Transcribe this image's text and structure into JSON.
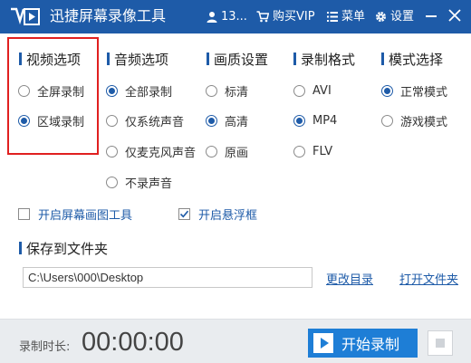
{
  "titlebar": {
    "title": "迅捷屏幕录像工具",
    "user": "13...",
    "buy_vip": "购买VIP",
    "menu": "菜单",
    "settings": "设置",
    "icons": [
      "logo-icon",
      "user-icon",
      "cart-icon",
      "menu-icon",
      "gear-icon",
      "minimize-icon",
      "close-icon"
    ]
  },
  "sections": {
    "video": {
      "label": "视频选项",
      "options": [
        {
          "label": "全屏录制",
          "checked": false
        },
        {
          "label": "区域录制",
          "checked": true
        }
      ]
    },
    "audio": {
      "label": "音频选项",
      "options": [
        {
          "label": "全部录制",
          "checked": true
        },
        {
          "label": "仅系统声音",
          "checked": false
        },
        {
          "label": "仅麦克风声音",
          "checked": false
        },
        {
          "label": "不录声音",
          "checked": false
        }
      ]
    },
    "quality": {
      "label": "画质设置",
      "options": [
        {
          "label": "标清",
          "checked": false
        },
        {
          "label": "高清",
          "checked": true
        },
        {
          "label": "原画",
          "checked": false
        }
      ]
    },
    "format": {
      "label": "录制格式",
      "options": [
        {
          "label": "AVI",
          "checked": false
        },
        {
          "label": "MP4",
          "checked": true
        },
        {
          "label": "FLV",
          "checked": false
        }
      ]
    },
    "mode": {
      "label": "模式选择",
      "options": [
        {
          "label": "正常模式",
          "checked": true
        },
        {
          "label": "游戏模式",
          "checked": false
        }
      ]
    }
  },
  "checkboxes": {
    "drawing_tool": {
      "label": "开启屏幕画图工具",
      "checked": false
    },
    "floating_frame": {
      "label": "开启悬浮框",
      "checked": true
    }
  },
  "save": {
    "label": "保存到文件夹",
    "path": "C:\\Users\\000\\Desktop",
    "change_dir": "更改目录",
    "open_folder": "打开文件夹"
  },
  "bottom": {
    "duration_label": "录制时长:",
    "duration_value": "00:00:00",
    "start_label": "开始录制"
  },
  "colors": {
    "accent": "#1e5ba8",
    "button": "#1e7ed6",
    "highlight_frame": "#e02020"
  }
}
